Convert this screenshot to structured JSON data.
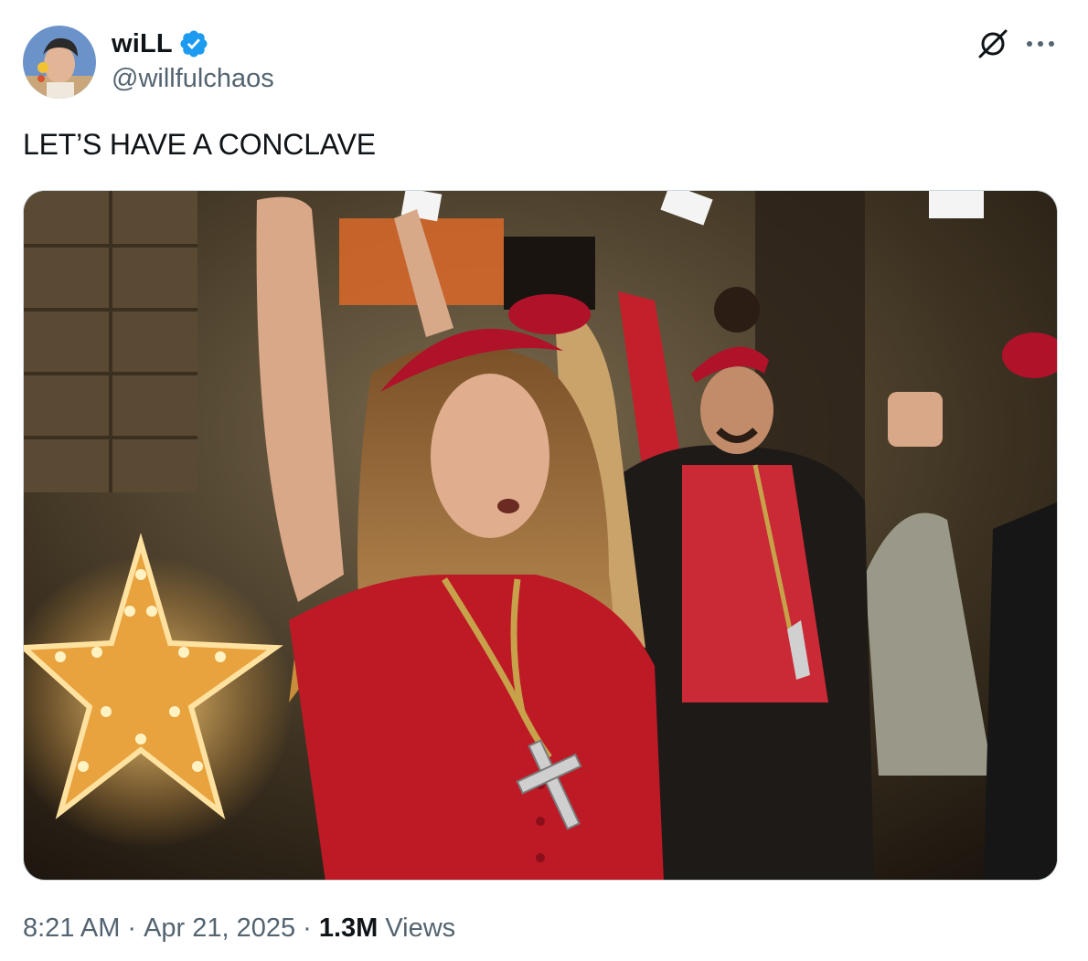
{
  "author": {
    "display_name": "wiLL",
    "handle": "@willfulchaos",
    "verified": true,
    "verified_color": "#1d9bf0"
  },
  "tweet": {
    "text": "LET’S HAVE A CONCLAVE"
  },
  "meta": {
    "time": "8:21 AM",
    "separator": "·",
    "date": "Apr 21, 2025",
    "views_count": "1.3M",
    "views_label": "Views"
  },
  "icons": {
    "grok": "grok-icon",
    "more": "more-icon",
    "verified": "verified-badge-icon"
  }
}
